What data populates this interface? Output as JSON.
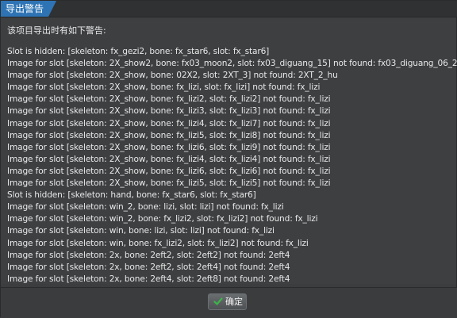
{
  "window": {
    "title": "导出警告"
  },
  "content": {
    "intro": "该项目导出时有如下警告:",
    "lines": [
      "Slot is hidden: [skeleton: fx_gezi2, bone: fx_star6, slot: fx_star6]",
      "Image for slot [skeleton: 2X_show2, bone: fx03_moon2, slot: fx03_diguang_15] not found: fx03_diguang_06_2",
      "Image for slot [skeleton: 2X_show, bone: 02X2, slot: 2XT_3] not found: 2XT_2_hu",
      "Image for slot [skeleton: 2X_show, bone: fx_lizi, slot: fx_lizi] not found: fx_lizi",
      "Image for slot [skeleton: 2X_show, bone: fx_lizi2, slot: fx_lizi2] not found: fx_lizi",
      "Image for slot [skeleton: 2X_show, bone: fx_lizi3, slot: fx_lizi3] not found: fx_lizi",
      "Image for slot [skeleton: 2X_show, bone: fx_lizi4, slot: fx_lizi7] not found: fx_lizi",
      "Image for slot [skeleton: 2X_show, bone: fx_lizi5, slot: fx_lizi8] not found: fx_lizi",
      "Image for slot [skeleton: 2X_show, bone: fx_lizi6, slot: fx_lizi9] not found: fx_lizi",
      "Image for slot [skeleton: 2X_show, bone: fx_lizi4, slot: fx_lizi4] not found: fx_lizi",
      "Image for slot [skeleton: 2X_show, bone: fx_lizi6, slot: fx_lizi6] not found: fx_lizi",
      "Image for slot [skeleton: 2X_show, bone: fx_lizi5, slot: fx_lizi5] not found: fx_lizi",
      "Slot is hidden: [skeleton: hand, bone: fx_star6, slot: fx_star6]",
      "Image for slot [skeleton: win_2, bone: lizi, slot: lizi] not found: fx_lizi",
      "Image for slot [skeleton: win_2, bone: fx_lizi2, slot: fx_lizi2] not found: fx_lizi",
      "Image for slot [skeleton: win, bone: lizi, slot: lizi] not found: fx_lizi",
      "Image for slot [skeleton: win, bone: fx_lizi2, slot: fx_lizi2] not found: fx_lizi",
      "Image for slot [skeleton: 2x, bone: 2eft2, slot: 2eft2] not found: 2eft4",
      "Image for slot [skeleton: 2x, bone: 2eft2, slot: 2eft4] not found: 2eft4",
      "Image for slot [skeleton: 2x, bone: 2eft4, slot: 2eft8] not found: 2eft4"
    ]
  },
  "footer": {
    "ok_label": "确定"
  },
  "icons": {
    "ok": "check-icon"
  },
  "colors": {
    "title_accent": "#2e74b5",
    "check_green": "#3bb54a"
  }
}
